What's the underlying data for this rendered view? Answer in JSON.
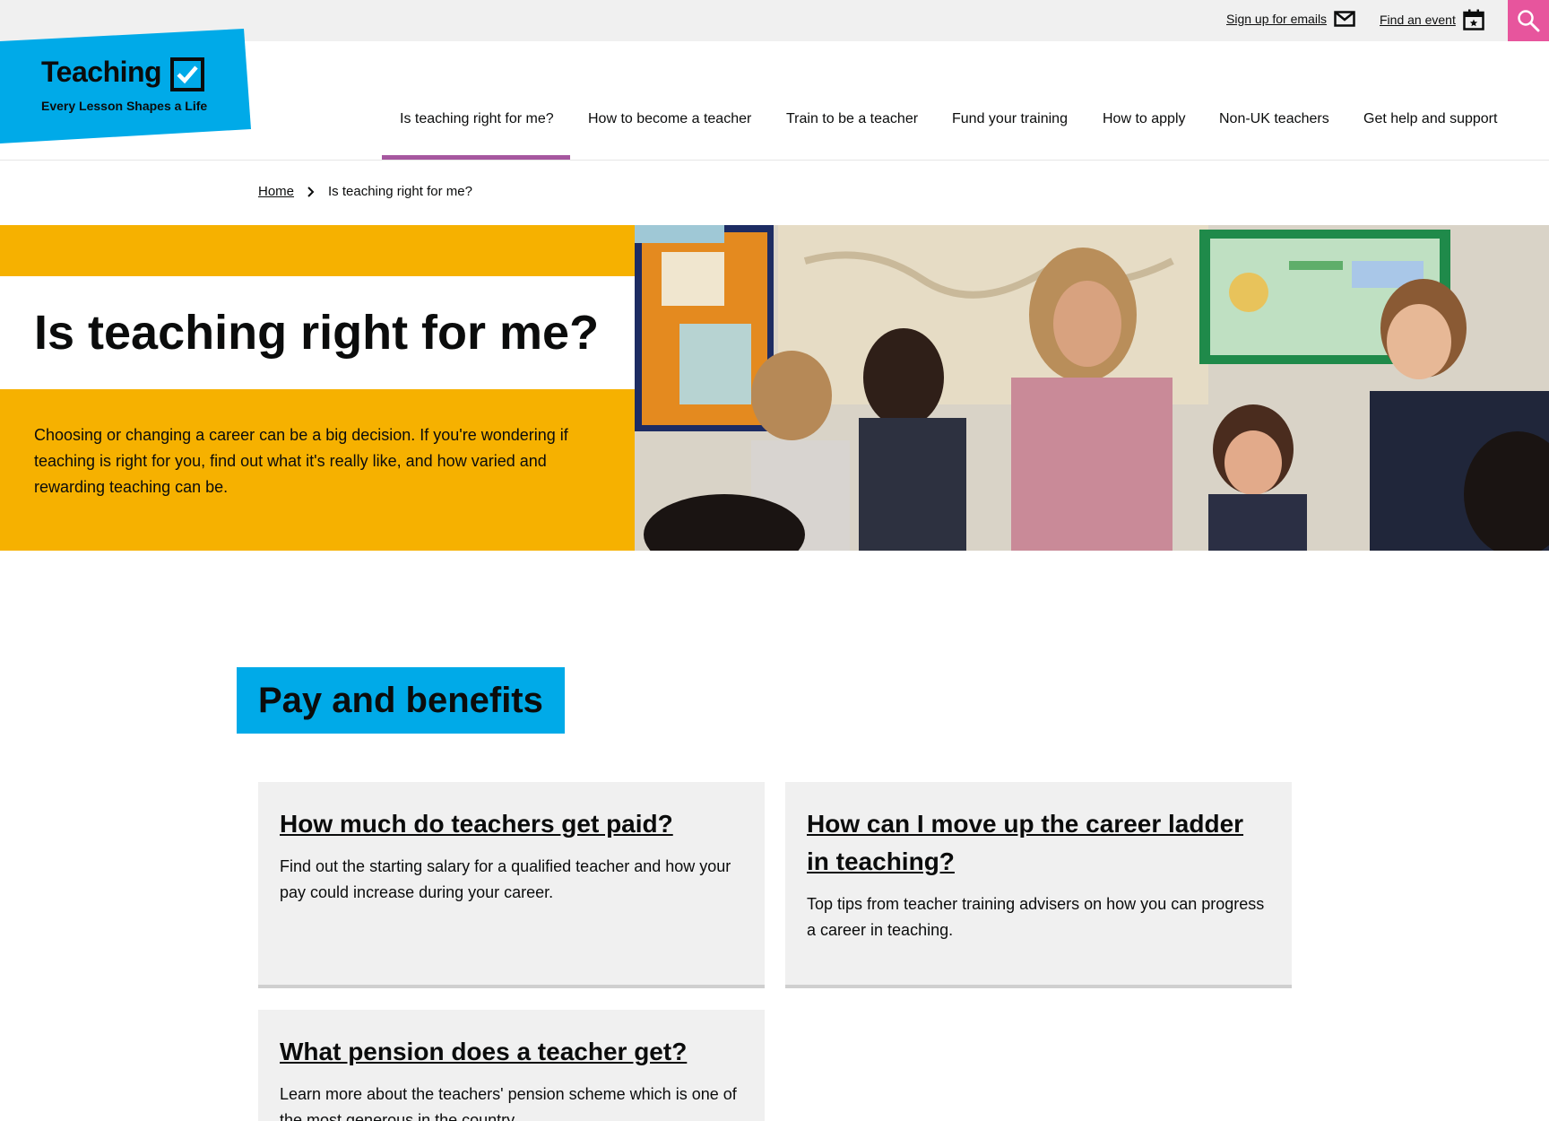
{
  "topbar": {
    "signup_label": "Sign up for emails",
    "event_label": "Find an event",
    "search_icon": "search-icon",
    "colors": {
      "search_bg": "#e7559d",
      "bar_bg": "#f0f0f0"
    }
  },
  "logo": {
    "title": "Teaching",
    "tagline": "Every Lesson Shapes a Life",
    "color": "#00aae8"
  },
  "nav": {
    "items": [
      {
        "label": "Is teaching right for me?",
        "active": true
      },
      {
        "label": "How to become a teacher"
      },
      {
        "label": "Train to be a teacher"
      },
      {
        "label": "Fund your training"
      },
      {
        "label": "How to apply"
      },
      {
        "label": "Non-UK teachers"
      },
      {
        "label": "Get help and support"
      }
    ],
    "active_color": "#a6579f"
  },
  "breadcrumb": {
    "home": "Home",
    "current": "Is teaching right for me?"
  },
  "hero": {
    "title": "Is teaching right for me?",
    "intro": "Choosing or changing a career can be a big decision. If you're wondering if teaching is right for you, find out what it's really like, and how varied and rewarding teaching can be.",
    "accent": "#f6b100"
  },
  "section": {
    "heading": "Pay and benefits",
    "cards": [
      {
        "title": "How much do teachers get paid?",
        "text": "Find out the starting salary for a qualified teacher and how your pay could increase during your career."
      },
      {
        "title": "How can I move up the career ladder in teaching?",
        "text": "Top tips from teacher training advisers on how you can progress a career in teaching."
      },
      {
        "title": "What pension does a teacher get?",
        "text": "Learn more about the teachers' pension scheme which is one of the most generous in the country."
      }
    ]
  }
}
